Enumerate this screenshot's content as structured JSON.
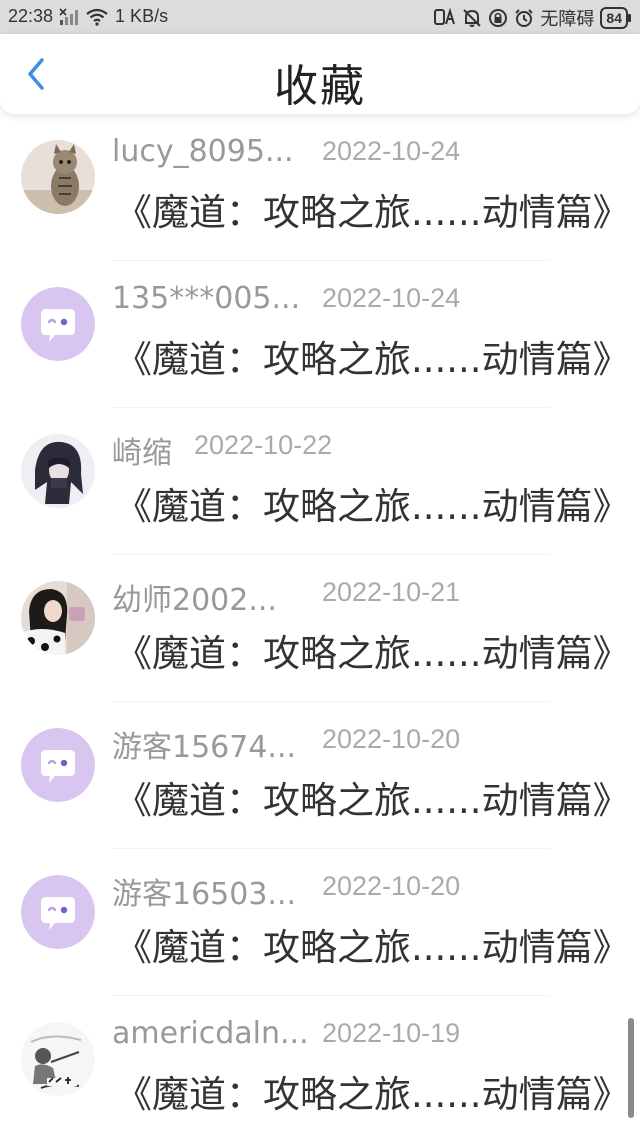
{
  "status_bar": {
    "time": "22:38",
    "speed": "1 KB/s",
    "accessibility": "无障碍",
    "battery": "84"
  },
  "header": {
    "title": "收藏"
  },
  "items": [
    {
      "user": "lucy_8095...",
      "date": "2022-10-24",
      "title": "《魔道：攻略之旅......动情篇》",
      "avatar": "cat-photo"
    },
    {
      "user": "135***005...",
      "date": "2022-10-24",
      "title": "《魔道：攻略之旅......动情篇》",
      "avatar": "default-chat-bubble"
    },
    {
      "user": "崎缩",
      "date": "2022-10-22",
      "title": "《魔道：攻略之旅......动情篇》",
      "avatar": "anime-character"
    },
    {
      "user": "幼师2002...",
      "date": "2022-10-21",
      "title": "《魔道：攻略之旅......动情篇》",
      "avatar": "girl-photo"
    },
    {
      "user": "游客15674...",
      "date": "2022-10-20",
      "title": "《魔道：攻略之旅......动情篇》",
      "avatar": "default-chat-bubble"
    },
    {
      "user": "游客16503...",
      "date": "2022-10-20",
      "title": "《魔道：攻略之旅......动情篇》",
      "avatar": "default-chat-bubble"
    },
    {
      "user": "americdaln...",
      "date": "2022-10-19",
      "title": "《魔道：攻略之旅......动情篇》",
      "avatar": "sketch-photo"
    }
  ],
  "colors": {
    "accent": "#3a8ee6",
    "default_avatar_bg": "#d9c6f0"
  }
}
